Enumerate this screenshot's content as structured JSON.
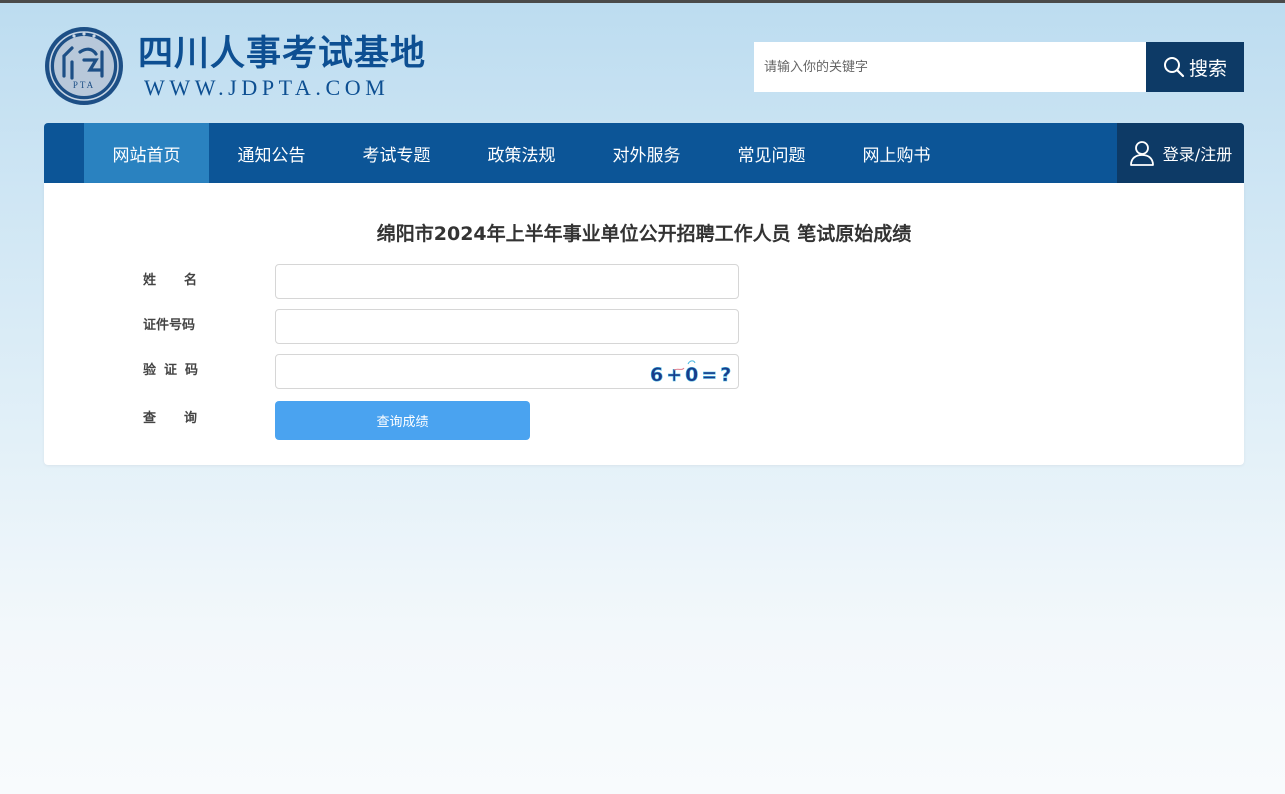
{
  "header": {
    "site_title": "四川人事考试基地",
    "site_url": "WWW.JDPTA.COM",
    "logo_letters": "PTA"
  },
  "search": {
    "placeholder": "请输入你的关键字",
    "button_label": "搜索"
  },
  "nav": {
    "items": [
      {
        "label": "网站首页",
        "active": true
      },
      {
        "label": "通知公告"
      },
      {
        "label": "考试专题"
      },
      {
        "label": "政策法规"
      },
      {
        "label": "对外服务"
      },
      {
        "label": "常见问题"
      },
      {
        "label": "网上购书"
      }
    ],
    "login_label": "登录/注册"
  },
  "form": {
    "title": "绵阳市2024年上半年事业单位公开招聘工作人员 笔试原始成绩",
    "name_label": "姓名",
    "id_label": "证件号码",
    "captcha_label": "验证码",
    "query_label": "查询",
    "captcha_text": "6+0=?",
    "submit_label": "查询成绩"
  },
  "colors": {
    "nav_bg": "#0c5597",
    "nav_active": "#2a82c0",
    "dark_blue": "#0d3a66",
    "submit_bg": "#4aa3f0",
    "brand_blue": "#0d4f92"
  }
}
